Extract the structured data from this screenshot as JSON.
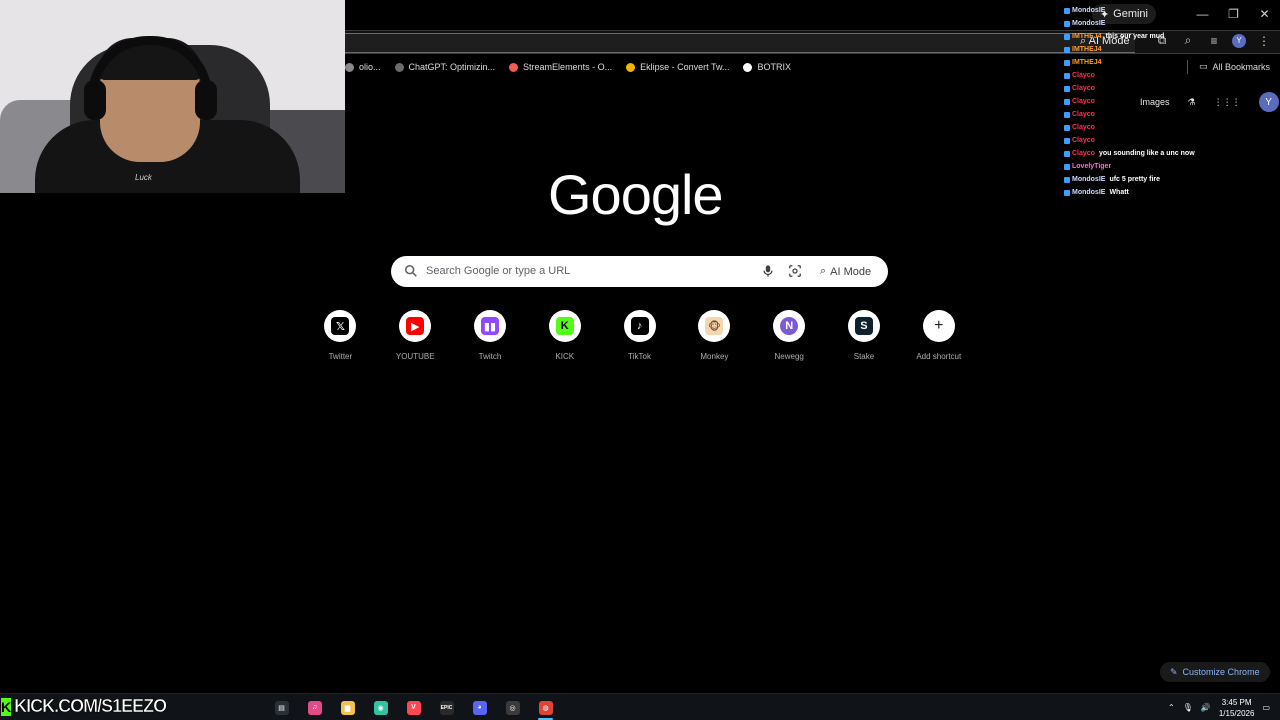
{
  "browser": {
    "gemini_label": "Gemini",
    "toolbar_ai_mode": "AI Mode",
    "bookmarks": [
      {
        "label": "olio...",
        "color": "#888888"
      },
      {
        "label": "ChatGPT: Optimizin...",
        "color": "#6b6b6b"
      },
      {
        "label": "StreamElements - O...",
        "color": "#f25c54"
      },
      {
        "label": "Eklipse - Convert Tw...",
        "color": "#f5b301"
      },
      {
        "label": "BOTRIX",
        "color": "#ffffff"
      }
    ],
    "all_bookmarks": "All Bookmarks",
    "avatar_letter": "Y"
  },
  "webcam": {
    "shirt_text": "Luck"
  },
  "google": {
    "logo": "Google",
    "search_placeholder": "Search Google or type a URL",
    "ai_mode": "AI Mode",
    "images_link": "Images",
    "avatar_letter": "Y",
    "customize_label": "Customize Chrome",
    "shortcuts": [
      {
        "label": "Twitter",
        "icon": "x-icon",
        "glyph": "𝕏",
        "bg": "#000000",
        "fg": "#ffffff"
      },
      {
        "label": "YOUTUBE",
        "icon": "youtube-icon",
        "glyph": "▶",
        "bg": "#ff0000",
        "fg": "#ffffff"
      },
      {
        "label": "Twitch",
        "icon": "twitch-icon",
        "glyph": "▮▮",
        "bg": "#9146ff",
        "fg": "#ffffff"
      },
      {
        "label": "KICK",
        "icon": "kick-icon",
        "glyph": "K",
        "bg": "#53fc18",
        "fg": "#000000"
      },
      {
        "label": "TikTok",
        "icon": "tiktok-icon",
        "glyph": "♪",
        "bg": "#000000",
        "fg": "#ffffff"
      },
      {
        "label": "Monkey",
        "icon": "monkey-icon",
        "glyph": "🐵",
        "bg": "#f3d7b1",
        "fg": "#7a4b25"
      },
      {
        "label": "Newegg",
        "icon": "newegg-icon",
        "glyph": "N",
        "bg": "#7b5cd6",
        "fg": "#ffffff"
      },
      {
        "label": "Stake",
        "icon": "stake-icon",
        "glyph": "S",
        "bg": "#0f212e",
        "fg": "#ffffff"
      },
      {
        "label": "Add shortcut",
        "icon": "plus-icon",
        "glyph": "+",
        "bg": "#ffffff",
        "fg": "#202124"
      }
    ]
  },
  "chat": [
    {
      "user": "MondosIE",
      "color": "#cfd8ff",
      "text": ""
    },
    {
      "user": "MondosIE",
      "color": "#cfd8ff",
      "text": ""
    },
    {
      "user": "IMTHEJ4",
      "color": "#ff9e2c",
      "text": "this our year mud"
    },
    {
      "user": "IMTHEJ4",
      "color": "#ff9e2c",
      "text": ""
    },
    {
      "user": "IMTHEJ4",
      "color": "#ff9e2c",
      "text": ""
    },
    {
      "user": "Clayco",
      "color": "#ff2f55",
      "text": ""
    },
    {
      "user": "Clayco",
      "color": "#ff2f55",
      "text": ""
    },
    {
      "user": "Clayco",
      "color": "#ff2f55",
      "text": ""
    },
    {
      "user": "Clayco",
      "color": "#ff2f55",
      "text": ""
    },
    {
      "user": "Clayco",
      "color": "#ff2f55",
      "text": ""
    },
    {
      "user": "Clayco",
      "color": "#ff2f55",
      "text": ""
    },
    {
      "user": "Clayco",
      "color": "#ff2f55",
      "text": "you sounding like a unc now"
    },
    {
      "user": "LovelyTiger",
      "color": "#ff6ad5",
      "text": ""
    },
    {
      "user": "MondosIE",
      "color": "#cfd8ff",
      "text": "ufc 5 pretty fire"
    },
    {
      "user": "MondosIE",
      "color": "#cfd8ff",
      "text": "Whatt"
    }
  ],
  "stream": {
    "kick_url": "KICK.COM/S1EEZO"
  },
  "taskbar": {
    "apps": [
      {
        "name": "task-view-icon",
        "glyph": "▤",
        "bg": "#2b2f36"
      },
      {
        "name": "itunes-icon",
        "glyph": "♫",
        "bg": "#e24a8a"
      },
      {
        "name": "file-explorer-icon",
        "glyph": "▆",
        "bg": "#f2c14e"
      },
      {
        "name": "streamlabs-icon",
        "glyph": "◉",
        "bg": "#31c3a2"
      },
      {
        "name": "valorant-icon",
        "glyph": "V",
        "bg": "#ff4655"
      },
      {
        "name": "epic-games-icon",
        "glyph": "EPIC",
        "bg": "#2a2a2a"
      },
      {
        "name": "discord-icon",
        "glyph": "◕",
        "bg": "#5865f2"
      },
      {
        "name": "obs-icon",
        "glyph": "◎",
        "bg": "#3a3a3a"
      },
      {
        "name": "chrome-icon",
        "glyph": "◍",
        "bg": "#db4437"
      }
    ],
    "time": "3:45 PM",
    "date": "1/15/2026"
  }
}
